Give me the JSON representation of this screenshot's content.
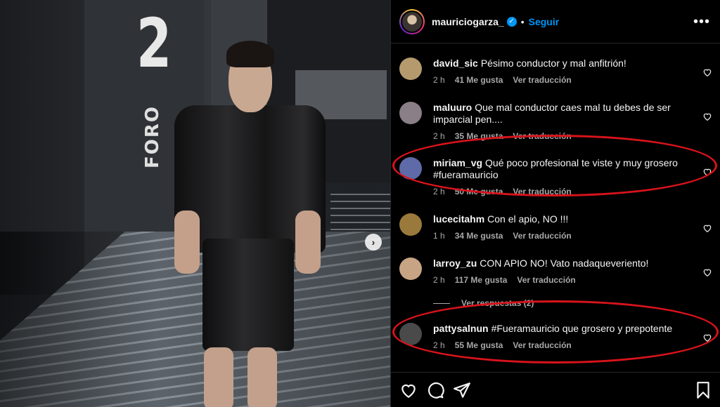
{
  "photo": {
    "wall_number": "2",
    "wall_text": "FORO",
    "next_icon": "chevron-right-icon"
  },
  "header": {
    "username": "mauriciogarza_",
    "verified": true,
    "separator": "•",
    "follow_label": "Seguir",
    "more_icon": "more-horizontal-icon"
  },
  "comments": [
    {
      "username": "david_sic",
      "text": "Pésimo conductor y mal anfitrión!",
      "time": "2 h",
      "likes": "41 Me gusta",
      "translate": "Ver traducción",
      "avatar_color": "#b59a6e"
    },
    {
      "username": "maluuro",
      "text": "Que mal conductor caes mal tu debes de ser imparcial pen....",
      "time": "2 h",
      "likes": "35 Me gusta",
      "translate": "Ver traducción",
      "avatar_color": "#8a7f86"
    },
    {
      "username": "miriam_vg",
      "text": "Qué poco profesional te viste y muy grosero #fueramauricio",
      "time": "2 h",
      "likes": "50 Me gusta",
      "translate": "Ver traducción",
      "avatar_color": "#5f6aa8"
    },
    {
      "username": "lucecitahm",
      "text": "Con el apio, NO !!!",
      "time": "1 h",
      "likes": "34 Me gusta",
      "translate": "Ver traducción",
      "avatar_color": "#9a7a3c"
    },
    {
      "username": "larroy_zu",
      "text": "CON APIO NO! Vato nadaqueveriento!",
      "time": "2 h",
      "likes": "117 Me gusta",
      "translate": "Ver traducción",
      "avatar_color": "#c7a483"
    },
    {
      "username": "pattysalnun",
      "text": "#Fueramauricio que grosero y prepotente",
      "time": "2 h",
      "likes": "55 Me gusta",
      "translate": "Ver traducción",
      "avatar_color": "#4a4a4a"
    }
  ],
  "replies_label": "Ver respuestas (2)",
  "actions": {
    "like_icon": "heart-icon",
    "comment_icon": "comment-icon",
    "share_icon": "send-icon",
    "save_icon": "bookmark-icon"
  },
  "colors": {
    "accent": "#0095f6",
    "annotation": "#d8131b",
    "background": "#000000",
    "muted_text": "#a8a8a8"
  }
}
